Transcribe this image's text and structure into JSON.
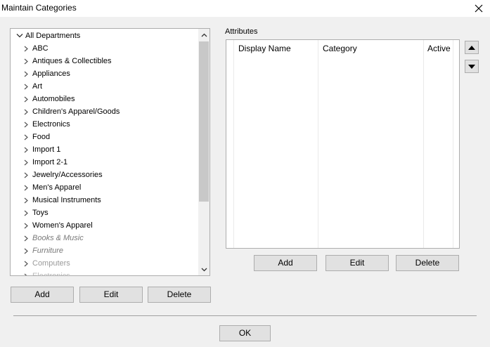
{
  "window": {
    "title": "Maintain Categories"
  },
  "tree": {
    "root_label": "All Departments",
    "items": [
      {
        "label": "ABC",
        "style": "normal"
      },
      {
        "label": "Antiques & Collectibles",
        "style": "normal"
      },
      {
        "label": "Appliances",
        "style": "normal"
      },
      {
        "label": "Art",
        "style": "normal"
      },
      {
        "label": "Automobiles",
        "style": "normal"
      },
      {
        "label": "Children's Apparel/Goods",
        "style": "normal"
      },
      {
        "label": "Electronics",
        "style": "normal"
      },
      {
        "label": "Food",
        "style": "normal"
      },
      {
        "label": "Import 1",
        "style": "normal"
      },
      {
        "label": "Import 2-1",
        "style": "normal"
      },
      {
        "label": "Jewelry/Accessories",
        "style": "normal"
      },
      {
        "label": "Men's Apparel",
        "style": "normal"
      },
      {
        "label": "Musical Instruments",
        "style": "normal"
      },
      {
        "label": "Toys",
        "style": "normal"
      },
      {
        "label": "Women's Apparel",
        "style": "normal"
      },
      {
        "label": "Books & Music",
        "style": "italic"
      },
      {
        "label": "Furniture",
        "style": "italic"
      },
      {
        "label": "Computers",
        "style": "disabled"
      },
      {
        "label": "Electronics",
        "style": "faint"
      }
    ]
  },
  "tree_buttons": {
    "add": "Add",
    "edit": "Edit",
    "delete": "Delete"
  },
  "attributes": {
    "label": "Attributes",
    "columns": [
      "Display Name",
      "Category",
      "Active"
    ],
    "add": "Add",
    "edit": "Edit",
    "delete": "Delete"
  },
  "footer": {
    "ok": "OK"
  }
}
